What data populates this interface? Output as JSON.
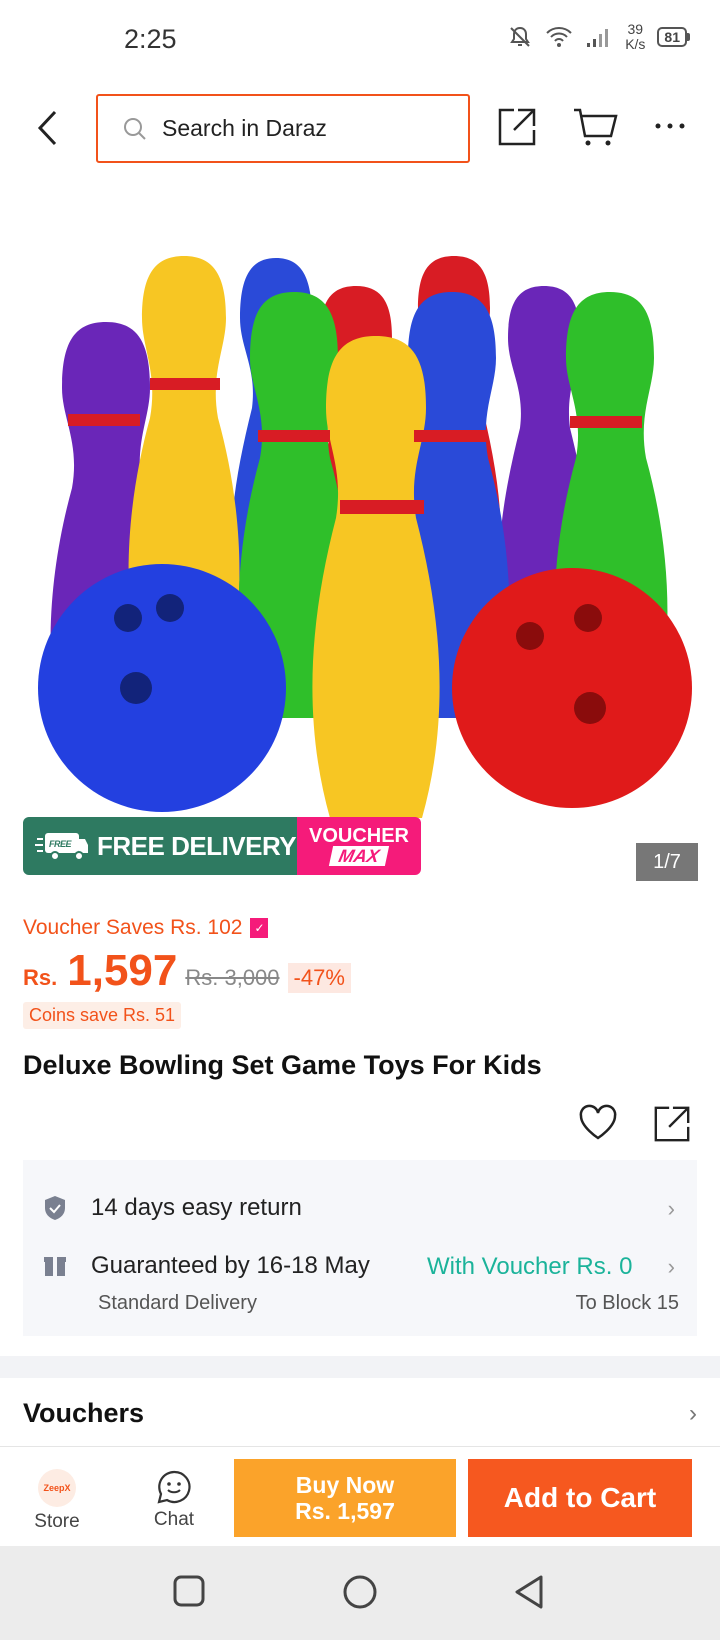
{
  "status_bar": {
    "time": "2:25",
    "net_speed_value": "39",
    "net_speed_unit": "K/s",
    "battery": "81"
  },
  "top_nav": {
    "search_placeholder": "Search in Daraz"
  },
  "gallery": {
    "counter": "1/7",
    "promo_free_label": "FREE DELIVERY",
    "promo_free_badge": "FREE",
    "promo_voucher_top": "VOUCHER",
    "promo_voucher_bottom": "MAX"
  },
  "pricing": {
    "voucher_saves": "Voucher Saves Rs. 102",
    "currency": "Rs.",
    "price": "1,597",
    "original_price": "Rs. 3,000",
    "discount": "-47%",
    "coins_save": "Coins save Rs. 51"
  },
  "product": {
    "title": "Deluxe Bowling Set Game Toys For Kids"
  },
  "services": {
    "return_text": "14 days easy return",
    "delivery_text": "Guaranteed by 16-18 May",
    "delivery_voucher": "With Voucher Rs. 0",
    "delivery_type": "Standard Delivery",
    "delivery_location": "To Block 15"
  },
  "vouchers": {
    "label": "Vouchers"
  },
  "action_bar": {
    "store_label": "Store",
    "store_logo_text": "ZeepX",
    "chat_label": "Chat",
    "buy_now_label": "Buy Now",
    "buy_now_price": "Rs. 1,597",
    "add_to_cart_label": "Add to Cart"
  },
  "colors": {
    "brand_orange": "#f2521a",
    "buy_now": "#fba32a",
    "add_to_cart": "#f6581f",
    "voucher_teal": "#1bb39a",
    "promo_green": "#2e7a61",
    "promo_pink": "#f51b7a"
  }
}
